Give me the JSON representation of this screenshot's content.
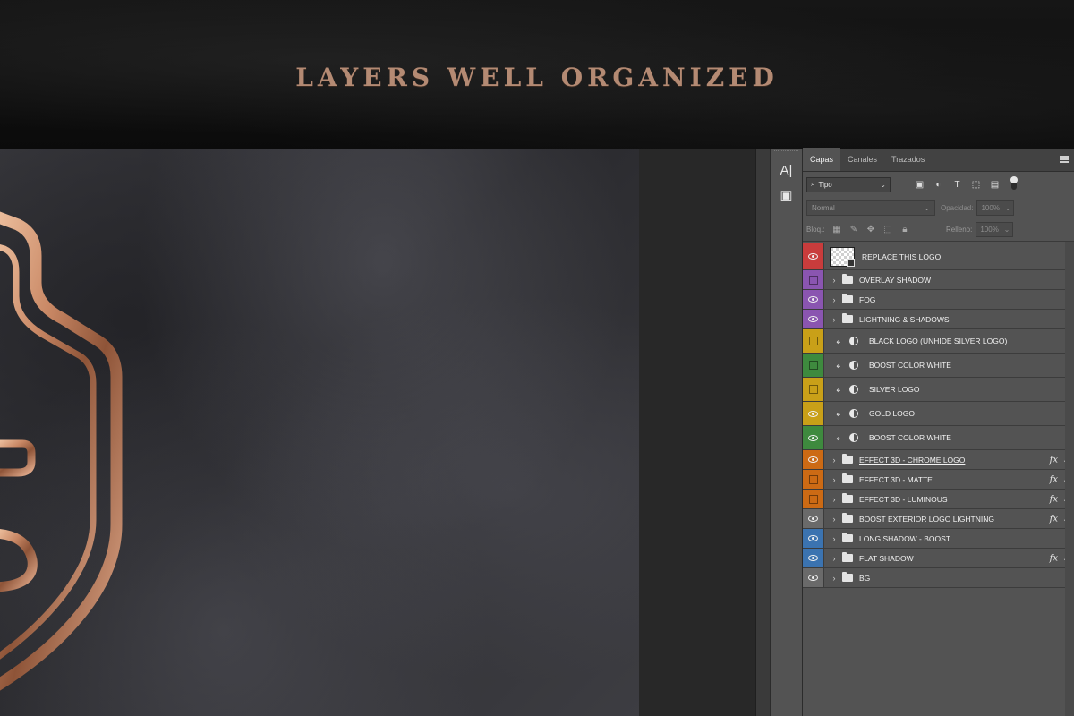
{
  "banner": {
    "title": "LAYERS WELL ORGANIZED"
  },
  "tools": [
    {
      "icon": "character-icon",
      "glyph": "A|"
    },
    {
      "icon": "3d-cube-icon",
      "glyph": "▣"
    }
  ],
  "panel": {
    "tabs": [
      {
        "label": "Capas",
        "active": true
      },
      {
        "label": "Canales",
        "active": false
      },
      {
        "label": "Trazados",
        "active": false
      }
    ],
    "filter": {
      "value": "Tipo",
      "chevron": "⌄"
    },
    "filter_icons": [
      "image-filter-icon",
      "adjustment-filter-icon",
      "type-filter-icon",
      "shape-filter-icon",
      "smart-object-filter-icon"
    ],
    "blend_mode": "Normal",
    "opacity_label": "Opacidad:",
    "opacity_value": "100%",
    "lock_label": "Bloq.:",
    "fill_label": "Relleno:",
    "fill_value": "100%"
  },
  "layers": [
    {
      "name": "REPLACE THIS LOGO",
      "color": "#c93c3c",
      "visible": true,
      "kind": "smart",
      "fx": false
    },
    {
      "name": "OVERLAY SHADOW",
      "color": "#8a55b0",
      "visible": false,
      "kind": "folder",
      "fx": false
    },
    {
      "name": "FOG",
      "color": "#8a55b0",
      "visible": true,
      "kind": "folder",
      "fx": false
    },
    {
      "name": "LIGHTNING & SHADOWS",
      "color": "#8a55b0",
      "visible": true,
      "kind": "folder",
      "fx": false
    },
    {
      "name": "BLACK LOGO (UNHIDE SILVER LOGO)",
      "color": "#c9a018",
      "visible": false,
      "kind": "adjust",
      "fx": false
    },
    {
      "name": "BOOST COLOR WHITE",
      "color": "#3e8a3e",
      "visible": false,
      "kind": "adjust",
      "fx": false
    },
    {
      "name": "SILVER LOGO",
      "color": "#c9a018",
      "visible": false,
      "kind": "adjust",
      "fx": false
    },
    {
      "name": "GOLD LOGO",
      "color": "#c9a018",
      "visible": true,
      "kind": "adjust",
      "fx": false
    },
    {
      "name": "BOOST COLOR WHITE",
      "color": "#3e8a3e",
      "visible": true,
      "kind": "adjust",
      "fx": false
    },
    {
      "name": "EFFECT 3D - CHROME LOGO",
      "color": "#cc6a14",
      "visible": true,
      "kind": "folder",
      "fx": true
    },
    {
      "name": "EFFECT 3D - MATTE",
      "color": "#cc6a14",
      "visible": false,
      "kind": "folder",
      "fx": true
    },
    {
      "name": "EFFECT 3D - LUMINOUS",
      "color": "#cc6a14",
      "visible": false,
      "kind": "folder",
      "fx": true
    },
    {
      "name": "BOOST EXTERIOR LOGO LIGHTNING",
      "color": "#6a6a6a",
      "visible": true,
      "kind": "folder",
      "fx": true
    },
    {
      "name": "LONG SHADOW - BOOST",
      "color": "#3b73b0",
      "visible": true,
      "kind": "folder",
      "fx": false
    },
    {
      "name": "FLAT SHADOW",
      "color": "#3b73b0",
      "visible": true,
      "kind": "folder",
      "fx": true
    },
    {
      "name": "BG",
      "color": "#6a6a6a",
      "visible": true,
      "kind": "folder",
      "fx": false
    }
  ],
  "fx_symbol": "fx"
}
